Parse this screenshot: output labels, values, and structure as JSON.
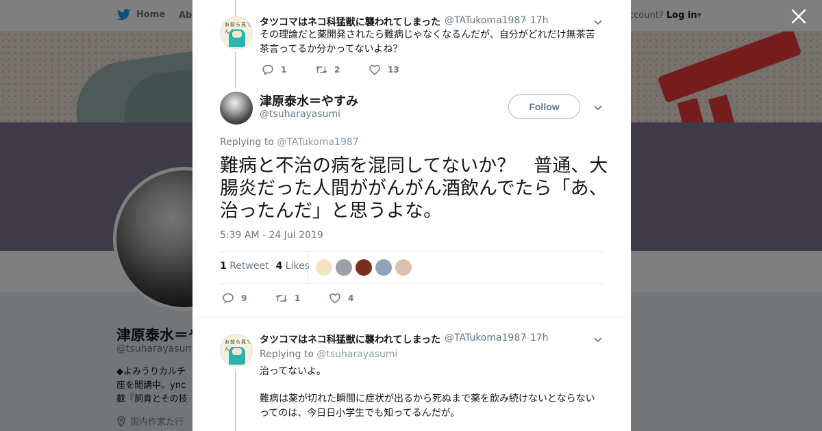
{
  "background": {
    "nav": {
      "home": "Home",
      "about": "Abo",
      "account_prompt": "ccount?",
      "login": "Log in"
    },
    "profile": {
      "name": "津原泰水＝や",
      "handle": "@tsuharayasumi",
      "bio_lines": [
        "◆よみうりカルチ",
        "座を開講中。ync",
        "載『飼育とその技"
      ],
      "location": "国内作家た行"
    }
  },
  "top_reply": {
    "name": "タツコマはネコ科猛獣に襲われてしまった",
    "handle": "@TATukoma1987",
    "time": "· 17h",
    "text": "その理論だと薬開発されたら難病じゃなくなるんだが、自分がどれだけ無茶苦茶言ってるか分かってないよね？",
    "replies": "1",
    "retweets": "2",
    "likes": "13"
  },
  "main_tweet": {
    "name": "津原泰水＝やすみ",
    "handle": "@tsuharayasumi",
    "follow_label": "Follow",
    "replying_prefix": "Replying to",
    "replying_to": "@TATukoma1987",
    "text": "難病と不治の病を混同してないか？　普通、大腸炎だった人間ががんがん酒飲んでたら「あ、治ったんだ」と思うよな。",
    "timestamp": "5:39 AM - 24 Jul 2019",
    "retweet_count": "1",
    "retweet_label": "Retweet",
    "like_count": "4",
    "like_label": "Likes",
    "replies": "9",
    "retweets": "1",
    "likes": "4",
    "liker_colors": [
      "#f3e3c3",
      "#9aa0a6",
      "#7a2f1e",
      "#8fa3b8",
      "#d9c2b0"
    ]
  },
  "bottom_reply": {
    "name": "タツコマはネコ科猛獣に襲われてしまった",
    "handle": "@TATukoma1987",
    "time": "· 17h",
    "replying_prefix": "Replying to",
    "replying_to": "@tsuharayasumi",
    "text_line1": "治ってないよ。",
    "text_line2": "難病は薬が切れた瞬間に症状が出るから死ぬまで薬を飲み続けないとならないってのは、今日日小学生でも知ってるんだが。"
  },
  "colors": {
    "accent": "#1da1f2",
    "muted": "#657786",
    "line": "#ccd6dd"
  }
}
